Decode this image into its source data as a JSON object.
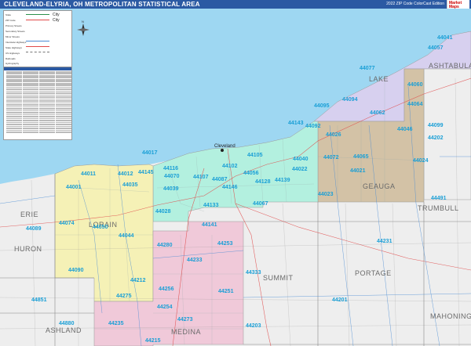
{
  "title": "CLEVELAND-ELYRIA, OH METROPOLITAN STATISTICAL AREA",
  "edition": "2022 ZIP Code ColorCast Edition",
  "logo_text": "Market Maps",
  "counties": [
    {
      "name": "LAKE"
    },
    {
      "name": "ASHTABULA"
    },
    {
      "name": "GEAUGA"
    },
    {
      "name": "TRUMBULL"
    },
    {
      "name": "ERIE"
    },
    {
      "name": "LORAIN"
    },
    {
      "name": "HURON"
    },
    {
      "name": "SUMMIT"
    },
    {
      "name": "PORTAGE"
    },
    {
      "name": "ASHLAND"
    },
    {
      "name": "MEDINA"
    },
    {
      "name": "MAHONING"
    }
  ],
  "cities": [
    {
      "name": "Cleveland"
    }
  ],
  "zip_labels": [
    "44041",
    "44057",
    "44077",
    "44060",
    "44094",
    "44064",
    "44099",
    "44046",
    "44062",
    "44095",
    "44026",
    "44022",
    "44072",
    "44021",
    "44065",
    "44023",
    "44024",
    "44040",
    "44092",
    "44143",
    "44139",
    "44017",
    "44011",
    "44012",
    "44145",
    "44070",
    "44116",
    "44107",
    "44102",
    "44105",
    "44128",
    "44146",
    "44056",
    "44087",
    "44001",
    "44035",
    "44039",
    "44028",
    "44133",
    "44141",
    "44067",
    "44089",
    "44074",
    "44050",
    "44044",
    "44090",
    "44280",
    "44253",
    "44256",
    "44233",
    "44212",
    "44275",
    "44251",
    "44254",
    "44273",
    "44215",
    "44235",
    "44880",
    "44851",
    "44203",
    "44333",
    "44201",
    "44231",
    "44491",
    "44202"
  ],
  "legend": {
    "items": [
      "State",
      "ZIP Code",
      "Primary Streets",
      "Secondary Streets",
      "Minor Streets",
      "Interstate Highways",
      "State Highways",
      "US Highways",
      "Railroads",
      "Hydrography"
    ],
    "samples": [
      "City",
      "City"
    ]
  },
  "colors": {
    "lake": "#9ed7f2",
    "outside": "#eeeeee",
    "cuyahoga": "#b3f0df",
    "lake_county": "#d7d0ef",
    "geauga": "#d3c2a6",
    "lorain": "#f5f1b6",
    "medina": "#f0c9d9",
    "zip_text": "#1a9fd6",
    "title_bar": "#2b5aa3"
  }
}
